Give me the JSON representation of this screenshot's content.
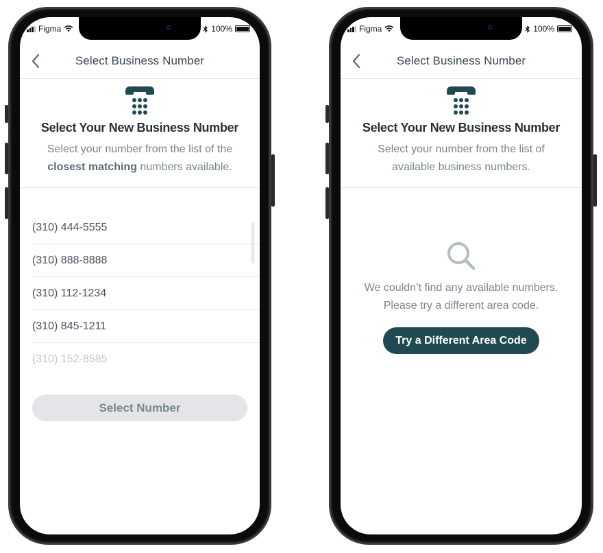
{
  "colors": {
    "brand_teal": "#1f4a52",
    "disabled_button": "#e3e5e8",
    "muted_text": "#7a8591",
    "heading_text": "#2a2f36"
  },
  "status_bar": {
    "carrier": "Figma",
    "battery": "100%",
    "icons": [
      "signal-icon",
      "wifi-icon",
      "bluetooth-icon",
      "battery-icon"
    ]
  },
  "screen_list": {
    "nav": {
      "title": "Select Business Number",
      "back_icon": "chevron-left-icon"
    },
    "header": {
      "icon": "desk-phone-icon",
      "heading": "Select Your New Business Number",
      "subtitle_before": "Select your number from the list of the ",
      "subtitle_bold": "closest matching",
      "subtitle_after": " numbers available."
    },
    "numbers": [
      "(310) 444-5555",
      "(310) 888-8888",
      "(310) 112-1234",
      "(310) 845-1211",
      "(310) 152-8585"
    ],
    "select_button": "Select Number"
  },
  "screen_empty": {
    "nav": {
      "title": "Select Business Number",
      "back_icon": "chevron-left-icon"
    },
    "header": {
      "icon": "desk-phone-icon",
      "heading": "Select Your New Business Number",
      "subtitle": "Select your number from the list of available business numbers."
    },
    "empty_state": {
      "icon": "search-icon",
      "message": "We couldn’t find any available numbers. Please try a different area code.",
      "button": "Try a Different Area Code"
    }
  }
}
